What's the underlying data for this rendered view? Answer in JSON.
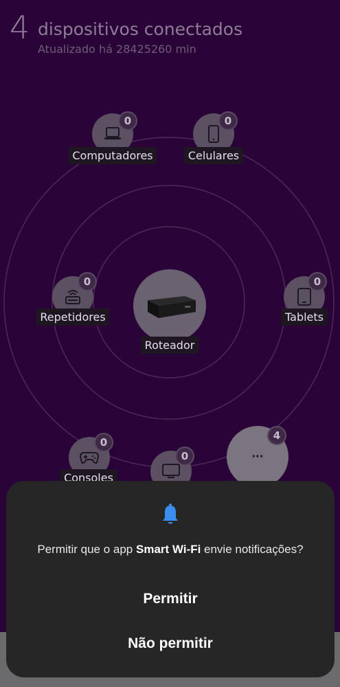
{
  "header": {
    "count": "4",
    "title": "dispositivos conectados",
    "updated": "Atualizado há 28425260 min"
  },
  "devices": {
    "computadores": {
      "label": "Computadores",
      "badge": "0",
      "icon": "laptop-icon"
    },
    "celulares": {
      "label": "Celulares",
      "badge": "0",
      "icon": "phone-icon"
    },
    "repetidores": {
      "label": "Repetidores",
      "badge": "0",
      "icon": "repeater-icon"
    },
    "tablets": {
      "label": "Tablets",
      "badge": "0",
      "icon": "tablet-icon"
    },
    "roteador": {
      "label": "Roteador",
      "icon": "router-image"
    },
    "consoles": {
      "label": "Consoles",
      "badge": "0",
      "icon": "gamepad-icon"
    },
    "tvs": {
      "badge": "0",
      "icon": "tv-icon"
    },
    "outros": {
      "badge": "4",
      "icon": "more-icon",
      "glyph": "···"
    }
  },
  "dialog": {
    "icon": "bell-icon",
    "message_pre": "Permitir que o app ",
    "app_name": "Smart Wi-Fi",
    "message_post": " envie notificações?",
    "allow_label": "Permitir",
    "deny_label": "Não permitir"
  },
  "colors": {
    "background": "#2a0338",
    "dialog": "#262626",
    "bell": "#3b8df0"
  }
}
